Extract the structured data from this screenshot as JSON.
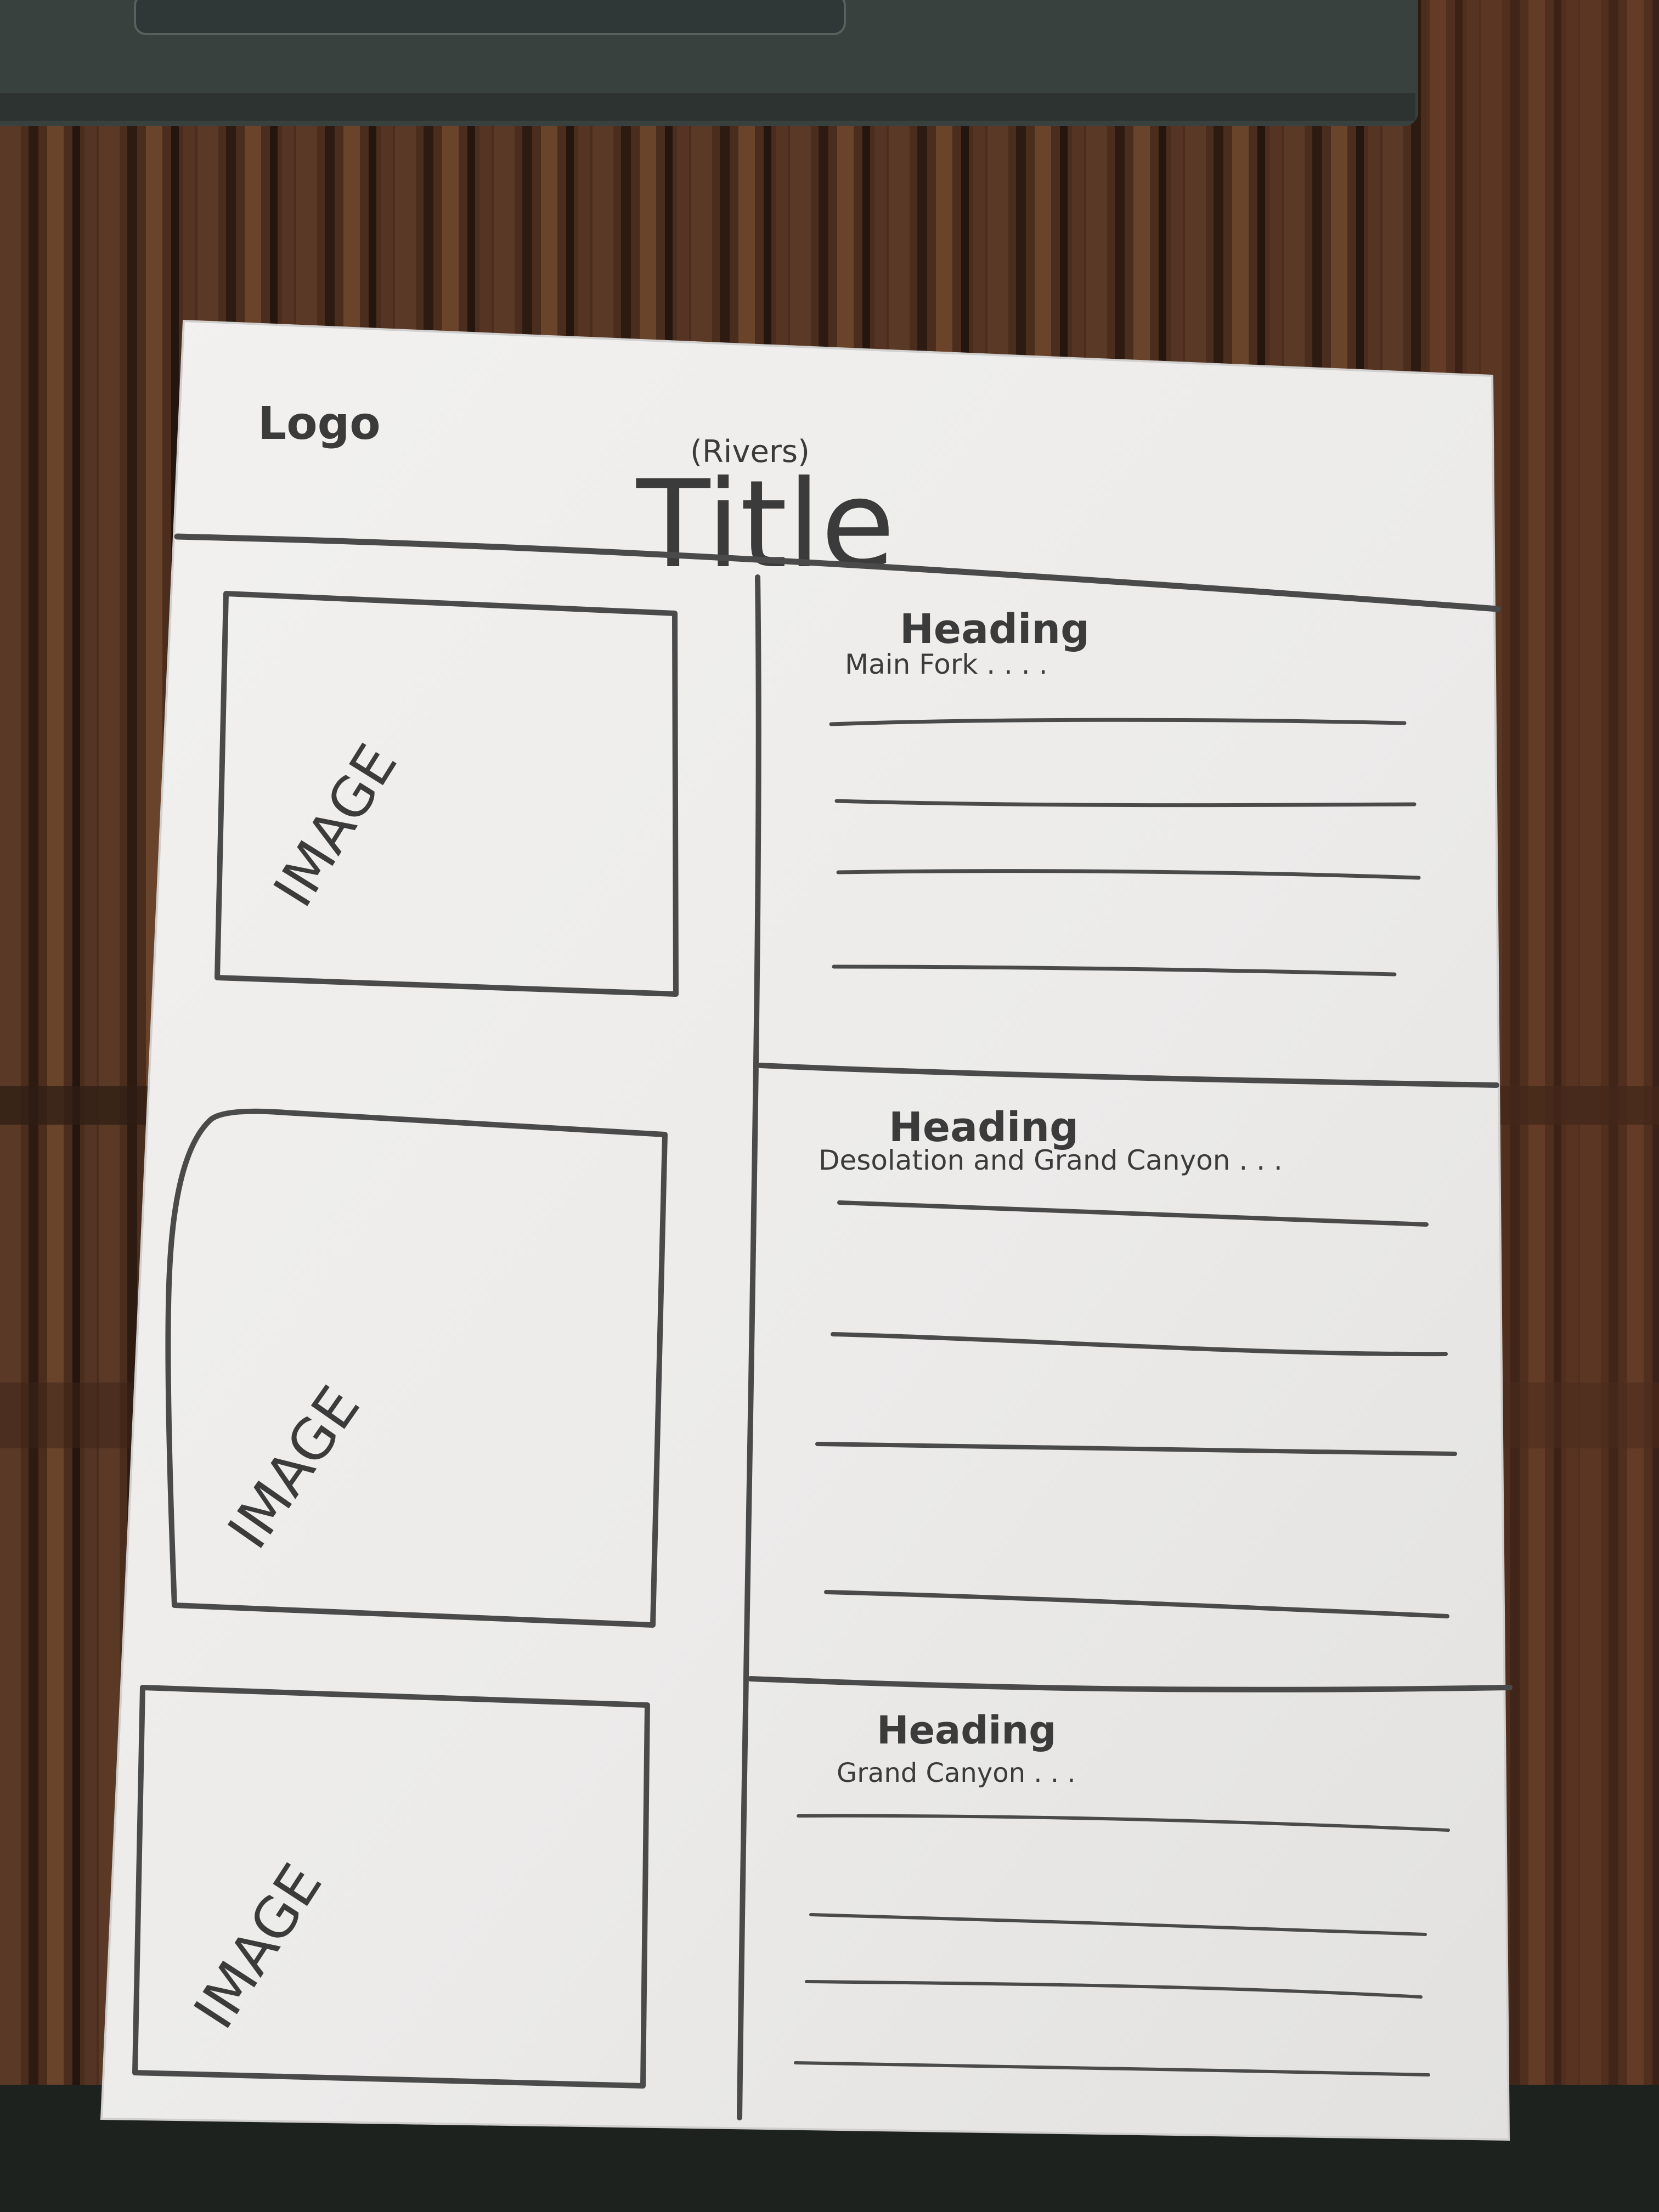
{
  "sketch": {
    "logo": "Logo",
    "subtitle": "(Rivers)",
    "title": "Title",
    "image_label": "IMAGE",
    "sections": [
      {
        "heading": "Heading",
        "text": "Main Fork . . . ."
      },
      {
        "heading": "Heading",
        "text": "Desolation and Grand Canyon . . ."
      },
      {
        "heading": "Heading",
        "text": "Grand Canyon . . ."
      }
    ]
  }
}
